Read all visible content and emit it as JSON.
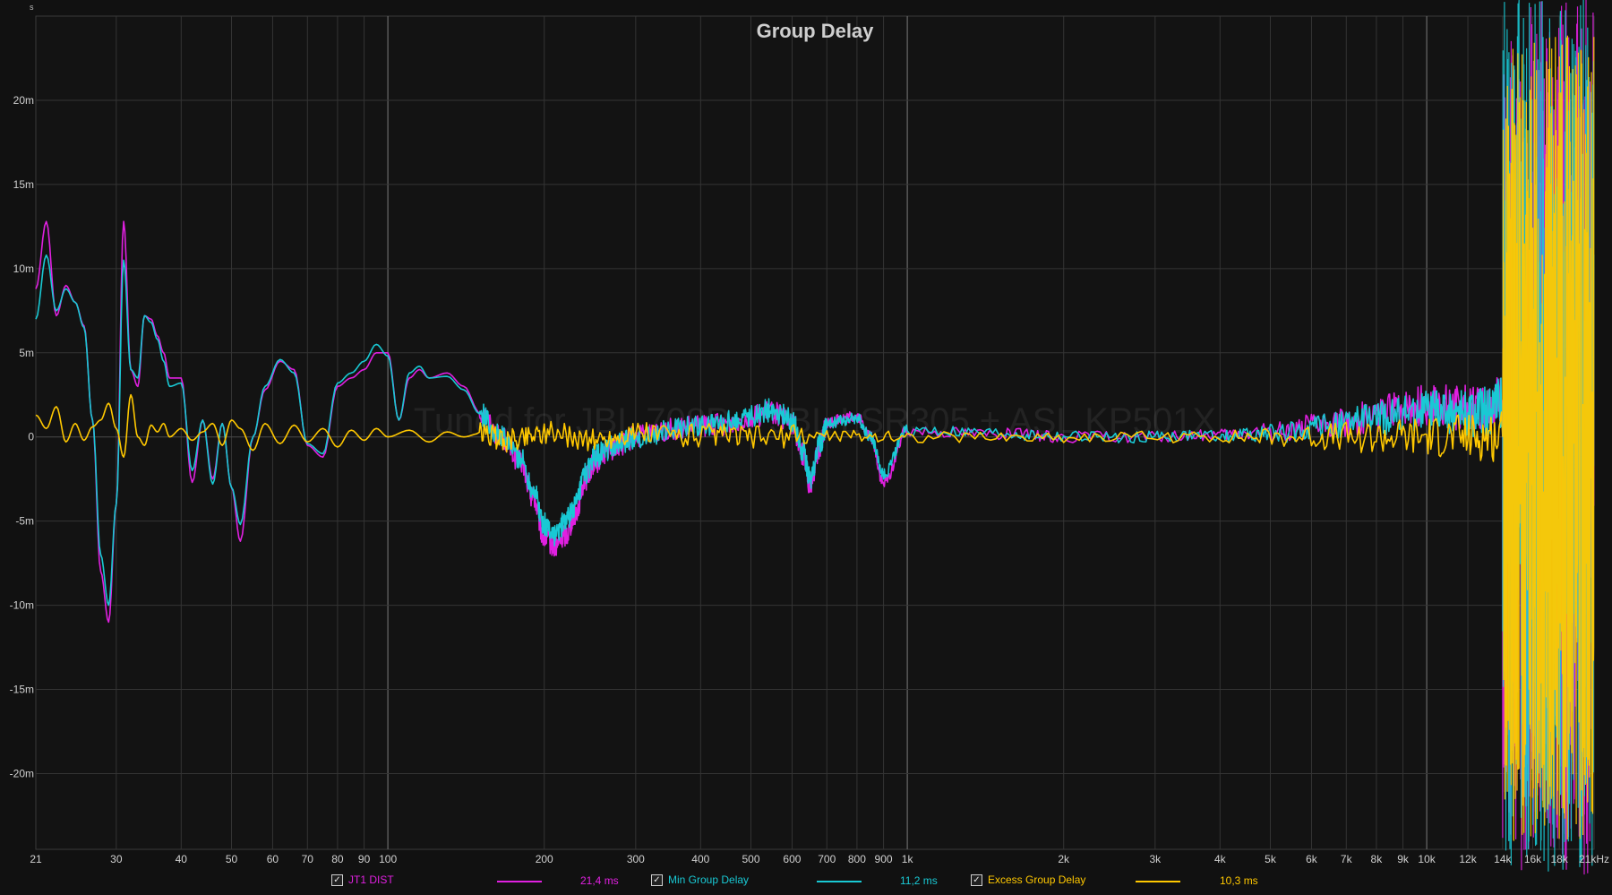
{
  "chart_data": {
    "type": "line",
    "title": "Group Delay",
    "watermark": "Tuned for JBL 708P + JBL LSR305 + ASL KP501X",
    "ylabel": "s",
    "xlabel": "",
    "x_scale": "log",
    "xlim": [
      21,
      21000
    ],
    "ylim": [
      -0.0245,
      0.025
    ],
    "grid": true,
    "x_ticks": [
      {
        "v": 21,
        "label": "21"
      },
      {
        "v": 30,
        "label": "30"
      },
      {
        "v": 40,
        "label": "40"
      },
      {
        "v": 50,
        "label": "50"
      },
      {
        "v": 60,
        "label": "60"
      },
      {
        "v": 70,
        "label": "70"
      },
      {
        "v": 80,
        "label": "80"
      },
      {
        "v": 90,
        "label": "90"
      },
      {
        "v": 100,
        "label": "100"
      },
      {
        "v": 200,
        "label": "200"
      },
      {
        "v": 300,
        "label": "300"
      },
      {
        "v": 400,
        "label": "400"
      },
      {
        "v": 500,
        "label": "500"
      },
      {
        "v": 600,
        "label": "600"
      },
      {
        "v": 700,
        "label": "700"
      },
      {
        "v": 800,
        "label": "800"
      },
      {
        "v": 900,
        "label": "900"
      },
      {
        "v": 1000,
        "label": "1k"
      },
      {
        "v": 2000,
        "label": "2k"
      },
      {
        "v": 3000,
        "label": "3k"
      },
      {
        "v": 4000,
        "label": "4k"
      },
      {
        "v": 5000,
        "label": "5k"
      },
      {
        "v": 6000,
        "label": "6k"
      },
      {
        "v": 7000,
        "label": "7k"
      },
      {
        "v": 8000,
        "label": "8k"
      },
      {
        "v": 9000,
        "label": "9k"
      },
      {
        "v": 10000,
        "label": "10k"
      },
      {
        "v": 12000,
        "label": "12k"
      },
      {
        "v": 14000,
        "label": "14k"
      },
      {
        "v": 16000,
        "label": "16k"
      },
      {
        "v": 18000,
        "label": "18k"
      },
      {
        "v": 21000,
        "label": "21kHz"
      }
    ],
    "major_x": [
      100,
      1000,
      10000
    ],
    "y_ticks": [
      {
        "v": 0.02,
        "label": "20m"
      },
      {
        "v": 0.015,
        "label": "15m"
      },
      {
        "v": 0.01,
        "label": "10m"
      },
      {
        "v": 0.005,
        "label": "5m"
      },
      {
        "v": 0,
        "label": "0"
      },
      {
        "v": -0.005,
        "label": "-5m"
      },
      {
        "v": -0.01,
        "label": "-10m"
      },
      {
        "v": -0.015,
        "label": "-15m"
      },
      {
        "v": -0.02,
        "label": "-20m"
      }
    ],
    "series": [
      {
        "name": "JT1 DIST",
        "color": "#e020e0",
        "legend_value": "21,4 ms",
        "x": [
          21,
          22,
          23,
          24,
          25,
          26,
          27,
          28,
          29,
          30,
          31,
          32,
          33,
          34,
          35,
          36,
          37,
          38,
          40,
          42,
          44,
          46,
          48,
          50,
          52,
          55,
          58,
          62,
          66,
          70,
          75,
          80,
          85,
          90,
          95,
          100,
          105,
          110,
          115,
          120,
          130,
          140,
          150,
          165,
          180,
          190,
          200,
          210,
          220,
          230,
          240,
          250,
          265,
          280,
          300,
          350,
          400,
          450,
          500,
          550,
          600,
          630,
          650,
          680,
          700,
          750,
          800,
          850,
          900,
          1000,
          1500,
          2000,
          3000,
          4000,
          5000,
          6000,
          7000,
          8000,
          9000,
          10000,
          11000,
          12000,
          13000,
          14000
        ],
        "y": [
          0.0088,
          0.0128,
          0.0072,
          0.009,
          0.008,
          0.0066,
          0.001,
          -0.008,
          -0.011,
          -0.004,
          0.0128,
          0.004,
          0.003,
          0.0072,
          0.007,
          0.006,
          0.005,
          0.0035,
          0.0035,
          -0.0027,
          0.001,
          -0.0025,
          0.0008,
          -0.003,
          -0.0062,
          0.0,
          0.0028,
          0.0045,
          0.004,
          -0.0005,
          -0.0012,
          0.003,
          0.0035,
          0.004,
          0.005,
          0.005,
          0.001,
          0.0035,
          0.004,
          0.0035,
          0.0038,
          0.003,
          0.0015,
          0.0,
          -0.0015,
          -0.0035,
          -0.006,
          -0.0065,
          -0.0058,
          -0.0045,
          -0.0025,
          -0.0015,
          -0.0008,
          -0.0005,
          0.0,
          0.0004,
          0.0006,
          0.0008,
          0.0012,
          0.0015,
          0.0008,
          -0.001,
          -0.0028,
          -0.0005,
          0.0008,
          0.0011,
          0.0012,
          0.0,
          -0.0028,
          0.0004,
          0.0002,
          0.0,
          0.0,
          0.0001,
          0.0003,
          0.0006,
          0.0009,
          0.0013,
          0.0017,
          0.0019,
          0.0018,
          0.0017,
          0.0018,
          0.0022
        ]
      },
      {
        "name": "Min Group Delay",
        "color": "#19c9d4",
        "legend_value": "11,2 ms",
        "x": [
          21,
          22,
          23,
          24,
          25,
          26,
          27,
          28,
          29,
          30,
          31,
          32,
          33,
          34,
          35,
          36,
          37,
          38,
          40,
          42,
          44,
          46,
          48,
          50,
          52,
          55,
          58,
          62,
          66,
          70,
          75,
          80,
          85,
          90,
          95,
          100,
          105,
          110,
          115,
          120,
          130,
          140,
          150,
          165,
          180,
          190,
          200,
          210,
          220,
          230,
          240,
          250,
          265,
          280,
          300,
          350,
          400,
          450,
          500,
          550,
          600,
          630,
          650,
          680,
          700,
          750,
          800,
          850,
          900,
          1000,
          1500,
          2000,
          3000,
          4000,
          5000,
          6000,
          7000,
          8000,
          9000,
          10000,
          11000,
          12000,
          13000,
          14000
        ],
        "y": [
          0.007,
          0.0108,
          0.0075,
          0.0088,
          0.008,
          0.0065,
          0.001,
          -0.007,
          -0.01,
          -0.004,
          0.0105,
          0.004,
          0.0035,
          0.0072,
          0.0068,
          0.0058,
          0.0045,
          0.003,
          0.0032,
          -0.002,
          0.001,
          -0.0028,
          0.0008,
          -0.003,
          -0.0052,
          0.0,
          0.003,
          0.0046,
          0.0038,
          -0.0004,
          -0.001,
          0.0032,
          0.0038,
          0.0045,
          0.0055,
          0.0048,
          0.001,
          0.0038,
          0.0042,
          0.0035,
          0.0036,
          0.0028,
          0.0014,
          0.0,
          -0.0012,
          -0.003,
          -0.0052,
          -0.0058,
          -0.005,
          -0.004,
          -0.0022,
          -0.0012,
          -0.0007,
          -0.0004,
          0.0,
          0.0004,
          0.0006,
          0.0009,
          0.0013,
          0.0016,
          0.001,
          -0.0008,
          -0.0025,
          -0.0004,
          0.0007,
          0.001,
          0.0011,
          0.0,
          -0.0022,
          0.0004,
          0.0002,
          0.0,
          0.0,
          0.0001,
          0.0002,
          0.0005,
          0.0008,
          0.0011,
          0.0014,
          0.0016,
          0.0015,
          0.0014,
          0.0015,
          0.002
        ]
      },
      {
        "name": "Excess Group Delay",
        "color": "#ffc800",
        "legend_value": "10,3 ms",
        "x": [
          21,
          22,
          23,
          24,
          25,
          26,
          27,
          28,
          29,
          30,
          31,
          32,
          33,
          34,
          35,
          36,
          37,
          38,
          40,
          42,
          44,
          46,
          48,
          50,
          52,
          55,
          58,
          62,
          66,
          70,
          75,
          80,
          85,
          90,
          95,
          100,
          110,
          120,
          130,
          140,
          150,
          170,
          200,
          250,
          300,
          400,
          500,
          700,
          1000,
          2000,
          4000,
          6000,
          8000,
          10000,
          12000,
          14000
        ],
        "y": [
          0.0013,
          0.0005,
          0.0018,
          -0.0003,
          0.0008,
          -0.0002,
          0.0006,
          0.001,
          0.002,
          0.0005,
          -0.0012,
          0.0025,
          0.0,
          -0.0005,
          0.0007,
          0.0003,
          0.0008,
          0.0,
          0.0005,
          -0.0002,
          0.0003,
          0.0008,
          -0.0005,
          0.001,
          0.0005,
          -0.0008,
          0.0008,
          -0.0004,
          0.0007,
          -0.0003,
          0.0005,
          -0.0006,
          0.0004,
          -0.0002,
          0.0005,
          0.0,
          0.0004,
          -0.0003,
          0.0003,
          0.0,
          0.0002,
          -0.0002,
          0.0003,
          -0.0002,
          0.0002,
          0.0001,
          0.0,
          0.0001,
          0.0,
          0.0,
          0.0,
          0.0,
          0.0,
          0.0,
          0.0,
          0.0
        ]
      }
    ]
  },
  "legend": [
    {
      "label": "JT1 DIST",
      "value": "21,4 ms",
      "color": "#e020e0",
      "check": "✓"
    },
    {
      "label": "Min Group Delay",
      "value": "11,2 ms",
      "color": "#19c9d4",
      "check": "✓"
    },
    {
      "label": "Excess Group Delay",
      "value": "10,3 ms",
      "color": "#ffc800",
      "check": "✓"
    }
  ]
}
